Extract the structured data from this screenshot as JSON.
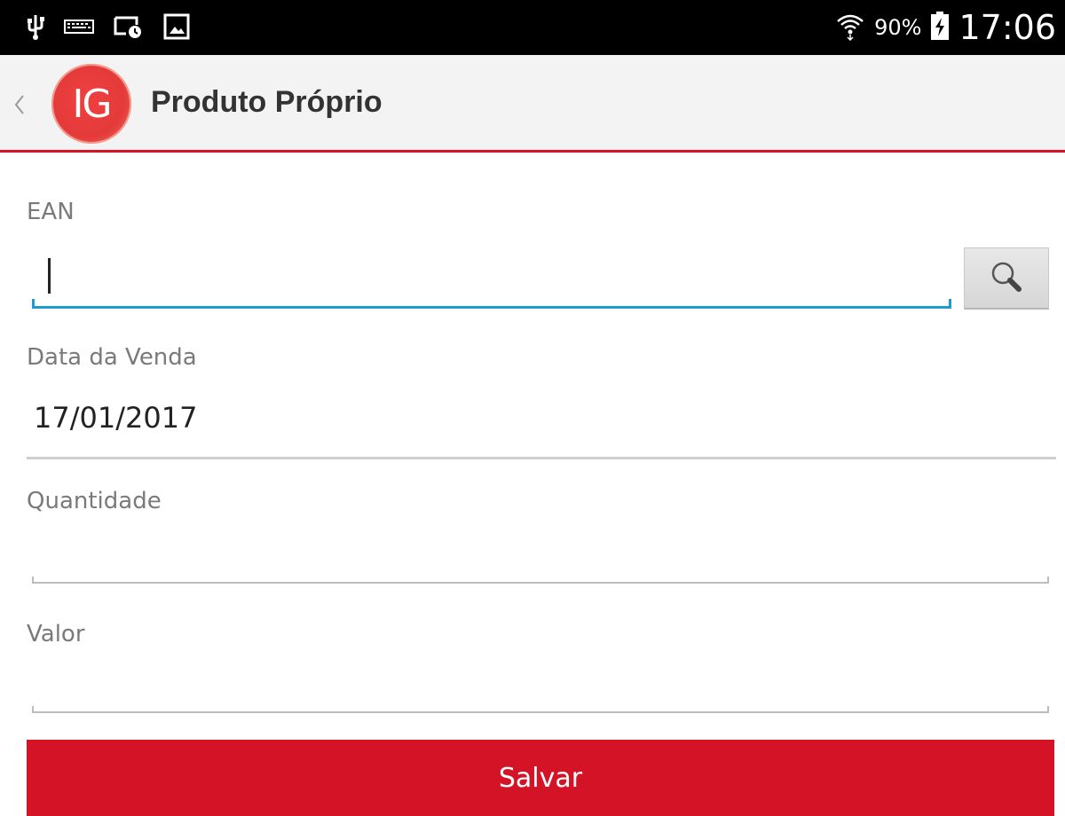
{
  "status_bar": {
    "battery": "90%",
    "time": "17:06",
    "icons": [
      "usb-icon",
      "keyboard-icon",
      "cast-icon",
      "gallery-icon",
      "wifi-icon",
      "battery-charging-icon"
    ]
  },
  "action_bar": {
    "logo_text": "IG",
    "title": "Produto Próprio"
  },
  "form": {
    "ean": {
      "label": "EAN",
      "value": "",
      "search_icon": "search-icon"
    },
    "sale_date": {
      "label": "Data da Venda",
      "value": "17/01/2017"
    },
    "quantity": {
      "label": "Quantidade",
      "value": ""
    },
    "value": {
      "label": "Valor",
      "value": ""
    },
    "save_label": "Salvar"
  },
  "colors": {
    "accent": "#d51327",
    "focus": "#1f9bd0",
    "status_bar_bg": "#000000",
    "action_bar_bg": "#f3f3f3"
  }
}
